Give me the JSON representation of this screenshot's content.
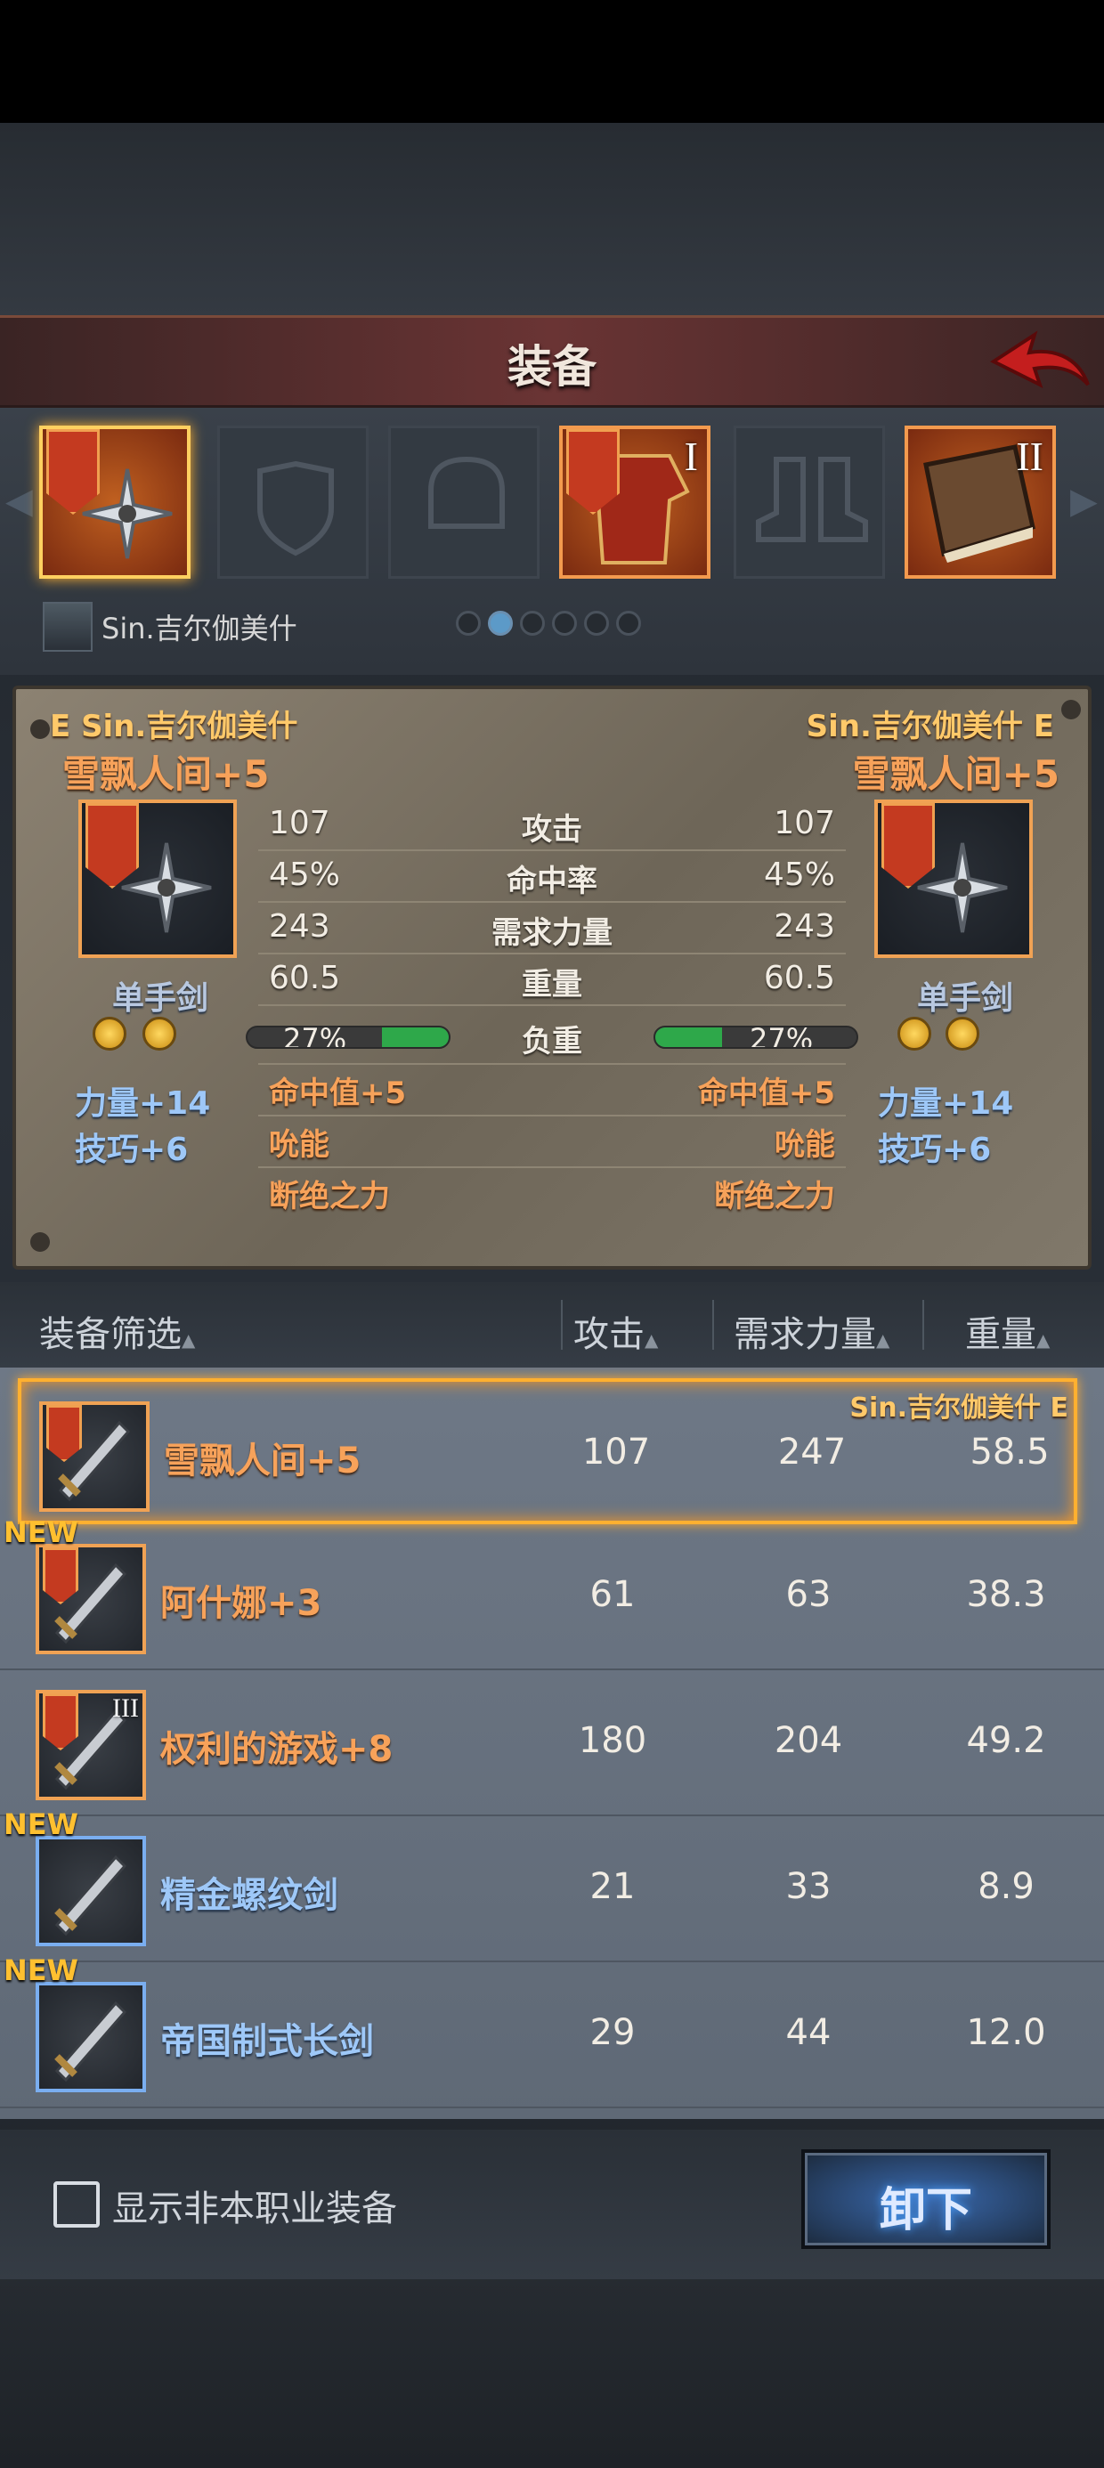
{
  "header": {
    "title": "装备",
    "back_icon": "back-arrow-icon"
  },
  "slots": [
    {
      "icon": "cross-sword-icon",
      "selected": true,
      "equipped": true,
      "tier": ""
    },
    {
      "icon": "shield-icon",
      "selected": false,
      "equipped": false,
      "tier": ""
    },
    {
      "icon": "helmet-icon",
      "selected": false,
      "equipped": false,
      "tier": ""
    },
    {
      "icon": "armor-icon",
      "selected": false,
      "equipped": true,
      "tier": "I"
    },
    {
      "icon": "boots-icon",
      "selected": false,
      "equipped": false,
      "tier": ""
    },
    {
      "icon": "book-icon",
      "selected": false,
      "equipped": true,
      "tier": "II"
    }
  ],
  "character": {
    "name": "Sin.吉尔伽美什"
  },
  "pager": {
    "count": 6,
    "active": 1
  },
  "compare": {
    "left": {
      "owner": "E Sin.吉尔伽美什",
      "item_name": "雪飘人间+5",
      "type": "单手剑",
      "bonus_str": "力量+14",
      "bonus_dex": "技巧+6"
    },
    "right": {
      "owner": "Sin.吉尔伽美什 E",
      "item_name": "雪飘人间+5",
      "type": "单手剑",
      "bonus_str": "力量+14",
      "bonus_dex": "技巧+6"
    },
    "stats": [
      {
        "label": "攻击",
        "left": "107",
        "right": "107"
      },
      {
        "label": "命中率",
        "left": "45%",
        "right": "45%"
      },
      {
        "label": "需求力量",
        "left": "243",
        "right": "243"
      },
      {
        "label": "重量",
        "left": "60.5",
        "right": "60.5"
      }
    ],
    "load": {
      "label": "负重",
      "left": "27%",
      "right": "27%",
      "fraction": 0.27
    },
    "effects_left": [
      "命中值+5",
      "吮能",
      "断绝之力"
    ],
    "effects_right": [
      "命中值+5",
      "吮能",
      "断绝之力"
    ]
  },
  "list_header": {
    "filter": "装备筛选",
    "attack": "攻击",
    "str_req": "需求力量",
    "weight": "重量"
  },
  "items": [
    {
      "name": "雪飘人间+5",
      "attack": "107",
      "str": "247",
      "weight": "58.5",
      "new": false,
      "selected": true,
      "owner": "Sin.吉尔伽美什 E",
      "color": "orange",
      "tier": ""
    },
    {
      "name": "阿什娜+3",
      "attack": "61",
      "str": "63",
      "weight": "38.3",
      "new": true,
      "selected": false,
      "owner": "",
      "color": "orange",
      "tier": ""
    },
    {
      "name": "权利的游戏+8",
      "attack": "180",
      "str": "204",
      "weight": "49.2",
      "new": false,
      "selected": false,
      "owner": "",
      "color": "orange",
      "tier": "III"
    },
    {
      "name": "精金螺纹剑",
      "attack": "21",
      "str": "33",
      "weight": "8.9",
      "new": true,
      "selected": false,
      "owner": "",
      "color": "blue",
      "tier": ""
    },
    {
      "name": "帝国制式长剑",
      "attack": "29",
      "str": "44",
      "weight": "12.0",
      "new": true,
      "selected": false,
      "owner": "",
      "color": "blue",
      "tier": ""
    }
  ],
  "new_badge": "NEW",
  "footer": {
    "checkbox_label": "显示非本职业装备",
    "unequip_label": "卸下"
  }
}
